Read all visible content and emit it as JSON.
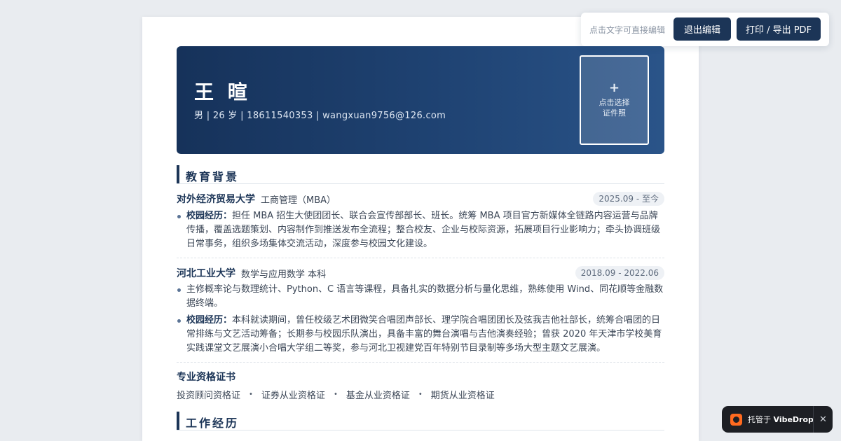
{
  "toolbar": {
    "hint": "点击文字可直接编辑",
    "exit_edit": "退出编辑",
    "print_export": "打印 / 导出 PDF"
  },
  "resume": {
    "name": "王 暄",
    "contact": "男 | 26 岁 | 18611540353 | wangxuan9756@126.com",
    "photo": {
      "plus": "+",
      "line1": "点击选择",
      "line2": "证件照"
    }
  },
  "education": {
    "title": "教育背景",
    "entries": [
      {
        "school": "对外经济贸易大学",
        "major": "工商管理（MBA）",
        "date": "2025.09 - 至今",
        "bullets": [
          {
            "label": "校园经历：",
            "text": "担任 MBA 招生大使团团长、联合会宣传部部长、班长。统筹 MBA 项目官方新媒体全链路内容运营与品牌传播，覆盖选题策划、内容制作到推送发布全流程；整合校友、企业与校际资源，拓展项目行业影响力；牵头协调班级日常事务，组织多场集体交流活动，深度参与校园文化建设。"
          }
        ]
      },
      {
        "school": "河北工业大学",
        "major": "数学与应用数学 本科",
        "date": "2018.09 - 2022.06",
        "bullets": [
          {
            "label": "",
            "text": "主修概率论与数理统计、Python、C 语言等课程，具备扎实的数据分析与量化思维，熟练使用 Wind、同花顺等金融数据终端。"
          },
          {
            "label": "校园经历：",
            "text": "本科就读期间，曾任校级艺术团微笑合唱团声部长、理学院合唱团团长及弦我吉他社部长，统筹合唱团的日常排练与文艺活动筹备；长期参与校园乐队演出，具备丰富的舞台演唱与吉他演奏经验；曾获 2020 年天津市学校美育实践课堂文艺展演小合唱大学组二等奖，参与河北卫视建党百年特别节目录制等多场大型主题文艺展演。"
          }
        ]
      }
    ]
  },
  "certificates": {
    "title": "专业资格证书",
    "items": [
      "投资顾问资格证",
      "证券从业资格证",
      "基金从业资格证",
      "期货从业资格证"
    ],
    "separator": "•"
  },
  "work": {
    "title": "工作经历"
  },
  "vibedrop": {
    "prefix": "托管于",
    "brand": "VibeDrop",
    "close": "✕"
  },
  "colors": {
    "accent": "#1c3557",
    "hero_start": "#16325a",
    "hero_end": "#2a5489",
    "badge_logo": "#ff6a1f"
  }
}
